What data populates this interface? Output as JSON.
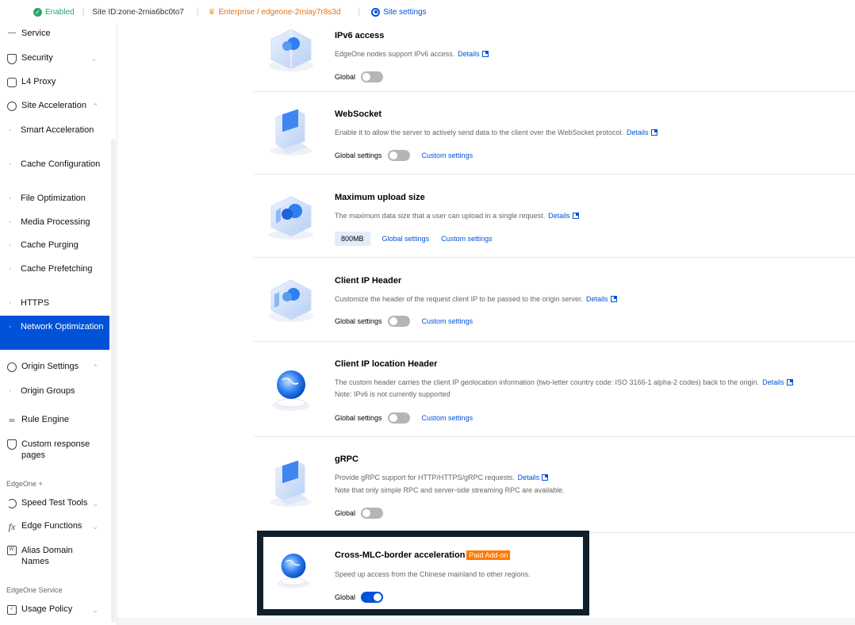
{
  "topbar": {
    "status": "Enabled",
    "site_id": "Site ID:zone-2rnia6bc0to7",
    "plan": "Enterprise / edgeone-2rniay7r8s3d",
    "site_settings": "Site settings"
  },
  "sidebar": {
    "items": [
      {
        "label": "Service"
      },
      {
        "label": "Security"
      },
      {
        "label": "L4 Proxy"
      },
      {
        "label": "Site Acceleration"
      },
      {
        "label": "Smart Acceleration"
      },
      {
        "label": "Cache Configuration"
      },
      {
        "label": "File Optimization"
      },
      {
        "label": "Media Processing"
      },
      {
        "label": "Cache Purging"
      },
      {
        "label": "Cache Prefetching"
      },
      {
        "label": "HTTPS"
      },
      {
        "label": "Network Optimization"
      },
      {
        "label": "Origin Settings"
      },
      {
        "label": "Origin Groups"
      },
      {
        "label": "Rule Engine"
      },
      {
        "label": "Custom response pages"
      },
      {
        "label": "Speed Test Tools"
      },
      {
        "label": "Edge Functions"
      },
      {
        "label": "Alias Domain Names"
      },
      {
        "label": "Usage Policy"
      }
    ],
    "groups": [
      "EdgeOne +",
      "EdgeOne Service"
    ]
  },
  "features": [
    {
      "title": "IPv6 access",
      "desc": "EdgeOne nodes support IPv6 access.",
      "details": "Details",
      "control_label": "Global",
      "toggle_on": false
    },
    {
      "title": "WebSocket",
      "desc": "Enable it to allow the server to actively send data to the client over the WebSocket protocol.",
      "details": "Details",
      "control_label": "Global settings",
      "custom": "Custom settings",
      "toggle_on": false
    },
    {
      "title": "Maximum upload size",
      "desc": "The maximum data size that a user can upload in a single request.",
      "details": "Details",
      "value": "800MB",
      "global": "Global settings",
      "custom": "Custom settings"
    },
    {
      "title": "Client IP Header",
      "desc": "Customize the header of the request client IP to be passed to the origin server.",
      "details": "Details",
      "control_label": "Global settings",
      "custom": "Custom settings",
      "toggle_on": false
    },
    {
      "title": "Client IP location Header",
      "desc": "The custom header carries the client IP geolocation information (two-letter country code: ISO 3166-1 alpha-2 codes) back to the origin.",
      "details": "Details",
      "note": "Note: IPv6 is not currently supported",
      "control_label": "Global settings",
      "custom": "Custom settings",
      "toggle_on": false
    },
    {
      "title": "gRPC",
      "desc": "Provide gRPC support for HTTP/HTTPS/gRPC requests.",
      "details": "Details",
      "note": "Note that only simple RPC and server-side streaming RPC are available.",
      "control_label": "Global",
      "toggle_on": false
    },
    {
      "title": "Cross-MLC-border acceleration",
      "badge": "Paid Add-on",
      "desc": "Speed up access from the Chinese mainland to other regions.",
      "control_label": "Global",
      "toggle_on": true
    }
  ],
  "colors": {
    "accent": "#0052d9",
    "enabled": "#2ba471",
    "badge": "#ff7a00"
  }
}
